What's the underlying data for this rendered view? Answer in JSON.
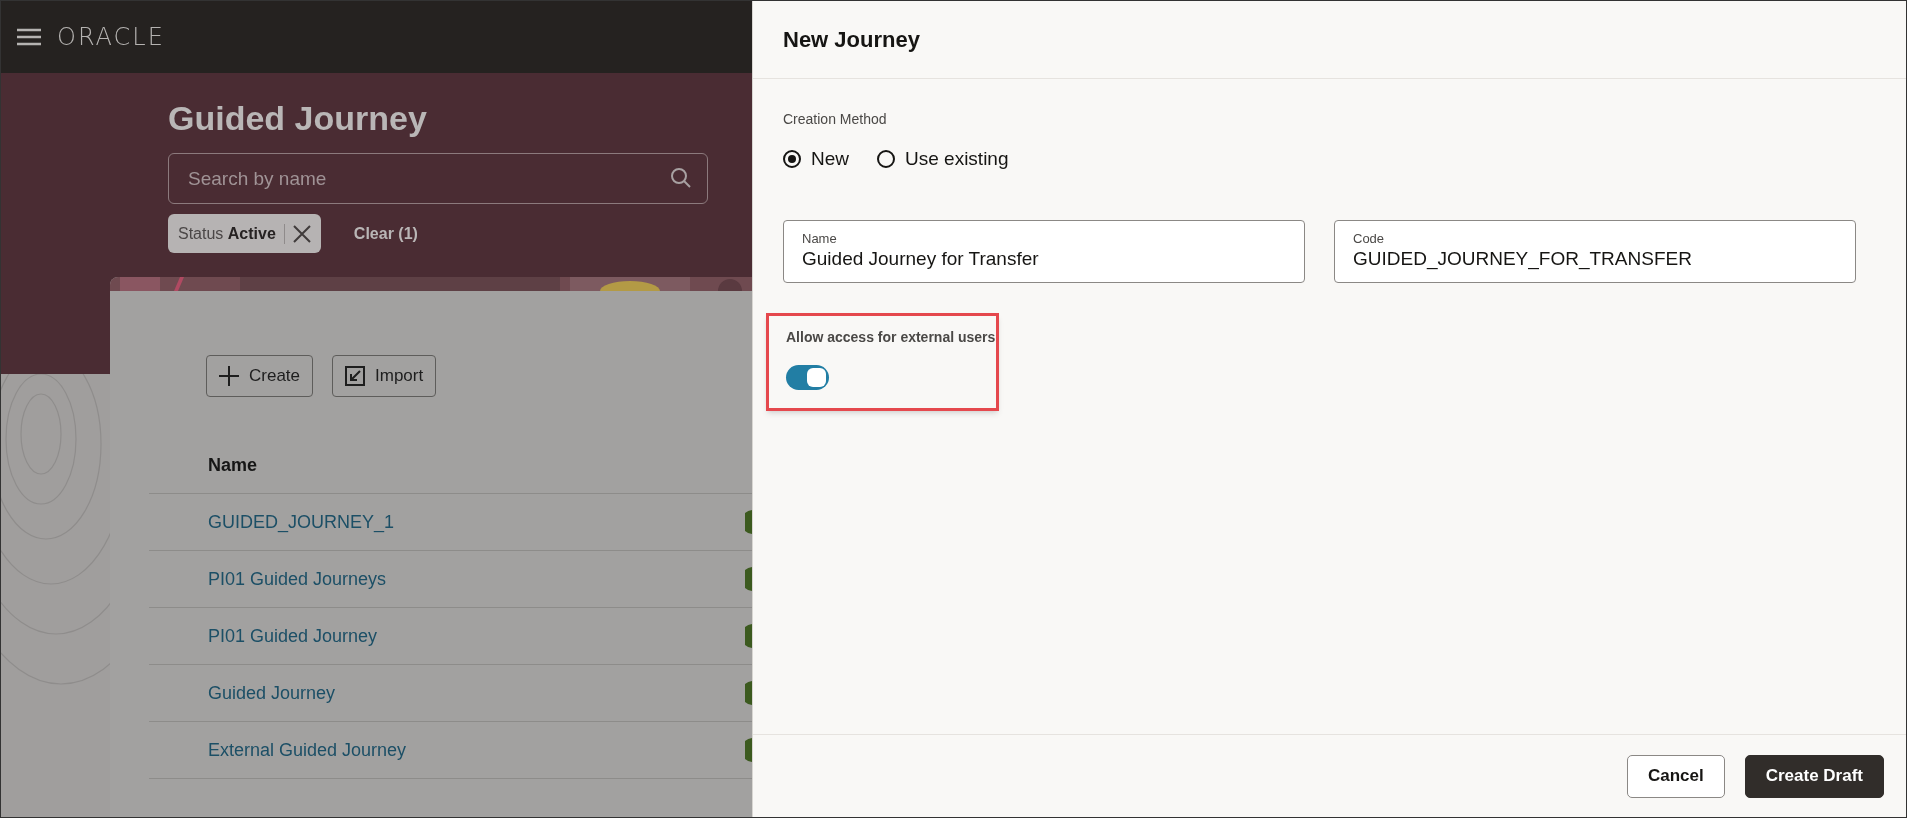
{
  "header": {
    "logo": "ORACLE"
  },
  "page": {
    "title": "Guided Journey",
    "search": {
      "placeholder": "Search by name"
    },
    "filter_chip": {
      "label": "Status",
      "value": "Active"
    },
    "clear_link": "Clear (1)",
    "actions": [
      {
        "kind": "create",
        "label": "Create"
      },
      {
        "kind": "import",
        "label": "Import"
      }
    ],
    "table": {
      "columns": [
        "Name"
      ],
      "rows": [
        {
          "name": "GUIDED_JOURNEY_1"
        },
        {
          "name": "PI01 Guided Journeys"
        },
        {
          "name": "PI01 Guided Journey"
        },
        {
          "name": "Guided Journey"
        },
        {
          "name": "External Guided Journey"
        }
      ]
    }
  },
  "dialog": {
    "title": "New Journey",
    "creation_method": {
      "label": "Creation Method",
      "options": [
        {
          "label": "New",
          "selected": true
        },
        {
          "label": "Use existing",
          "selected": false
        }
      ]
    },
    "fields": [
      {
        "label": "Name",
        "value": "Guided Journey for Transfer"
      },
      {
        "label": "Code",
        "value": "GUIDED_JOURNEY_FOR_TRANSFER"
      }
    ],
    "toggle": {
      "label": "Allow access for external users",
      "on": true,
      "highlighted": true
    },
    "buttons": [
      {
        "kind": "secondary",
        "label": "Cancel"
      },
      {
        "kind": "primary",
        "label": "Create Draft"
      }
    ]
  }
}
